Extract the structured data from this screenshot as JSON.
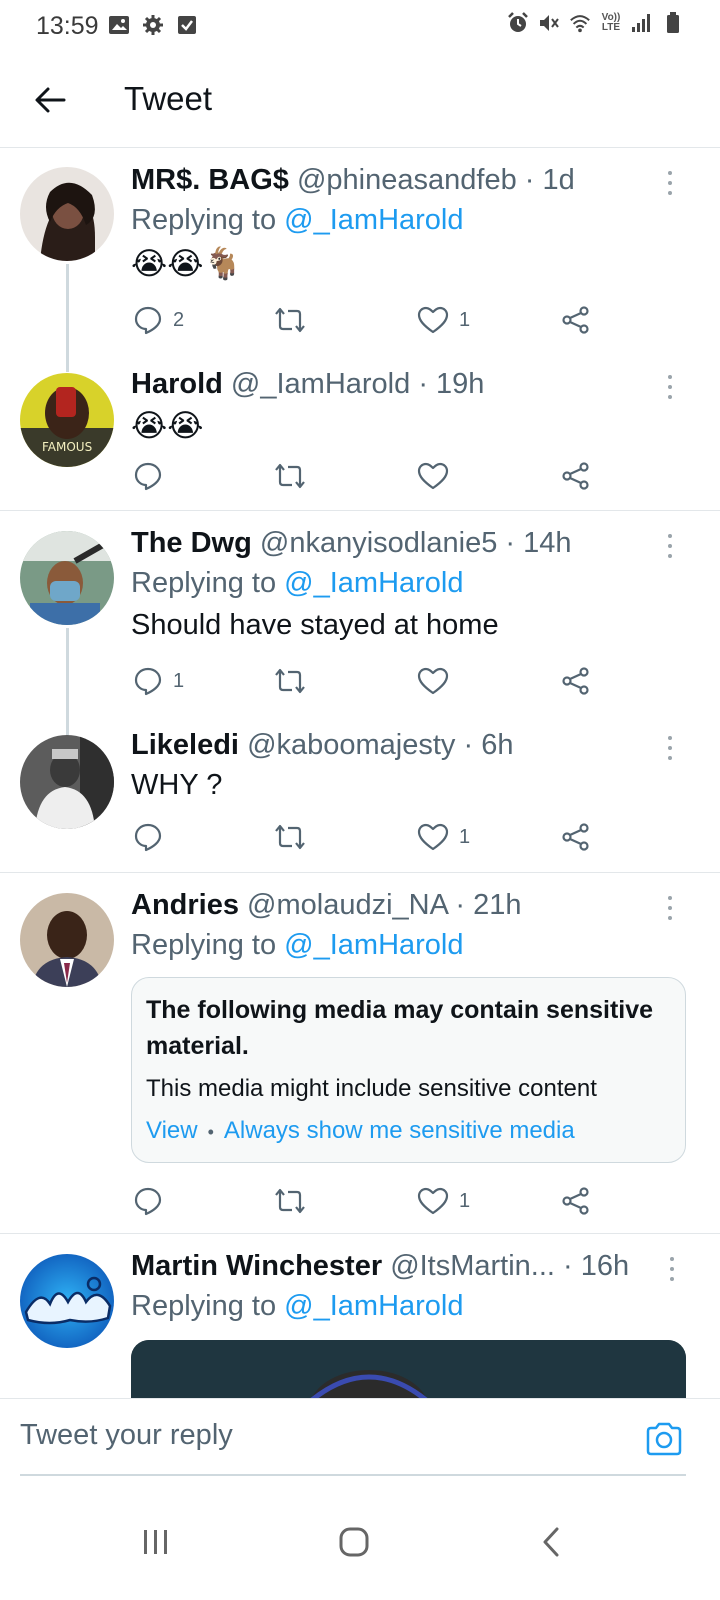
{
  "status_bar": {
    "time": "13:59",
    "left_icons": [
      "gallery-icon",
      "gear-icon",
      "checkbox-icon"
    ],
    "right_icons": [
      "alarm-icon",
      "mute-icon",
      "wifi-icon",
      "volte-icon",
      "signal-icon",
      "battery-icon"
    ],
    "volte_line1": "Vo))",
    "volte_line2": "LTE"
  },
  "header": {
    "title": "Tweet"
  },
  "tweets": [
    {
      "name": "MR$. BAG$",
      "handle": "@phineasandfeb",
      "time": "1d",
      "replying_prefix": "Replying to ",
      "replying_to": "@_IamHarold",
      "text": "😭😭🐐",
      "reply_count": "2",
      "retweet_count": "",
      "like_count": "1"
    },
    {
      "name": "Harold",
      "handle": "@_IamHarold",
      "time": "19h",
      "text": "😭😭",
      "reply_count": "",
      "retweet_count": "",
      "like_count": ""
    },
    {
      "name": "The Dwg",
      "handle": "@nkanyisodlanie5",
      "time": "14h",
      "replying_prefix": "Replying to ",
      "replying_to": "@_IamHarold",
      "text": "Should have stayed at home",
      "reply_count": "1",
      "retweet_count": "",
      "like_count": ""
    },
    {
      "name": "Likeledi",
      "handle": "@kaboomajesty",
      "time": "6h",
      "text": "WHY ?",
      "reply_count": "",
      "retweet_count": "",
      "like_count": "1"
    },
    {
      "name": "Andries",
      "handle": "@molaudzi_NA",
      "time": "21h",
      "replying_prefix": "Replying to ",
      "replying_to": "@_IamHarold",
      "sensitive_title": "The following media may contain sensitive material.",
      "sensitive_desc": "This media might include sensitive content",
      "sensitive_view": "View",
      "sensitive_sep": "•",
      "sensitive_always": "Always show me sensitive media",
      "reply_count": "",
      "retweet_count": "",
      "like_count": "1"
    },
    {
      "name": "Martin Winchester",
      "handle": "@ItsMartin...",
      "time": "16h",
      "replying_prefix": "Replying to ",
      "replying_to": "@_IamHarold"
    }
  ],
  "reply_bar": {
    "placeholder": "Tweet your reply"
  },
  "colors": {
    "accent": "#1d9bf0",
    "secondary_text": "#536471",
    "divider": "#e3e7ea"
  },
  "nav": {
    "icons": [
      "recents-icon",
      "home-icon",
      "back-icon"
    ]
  }
}
